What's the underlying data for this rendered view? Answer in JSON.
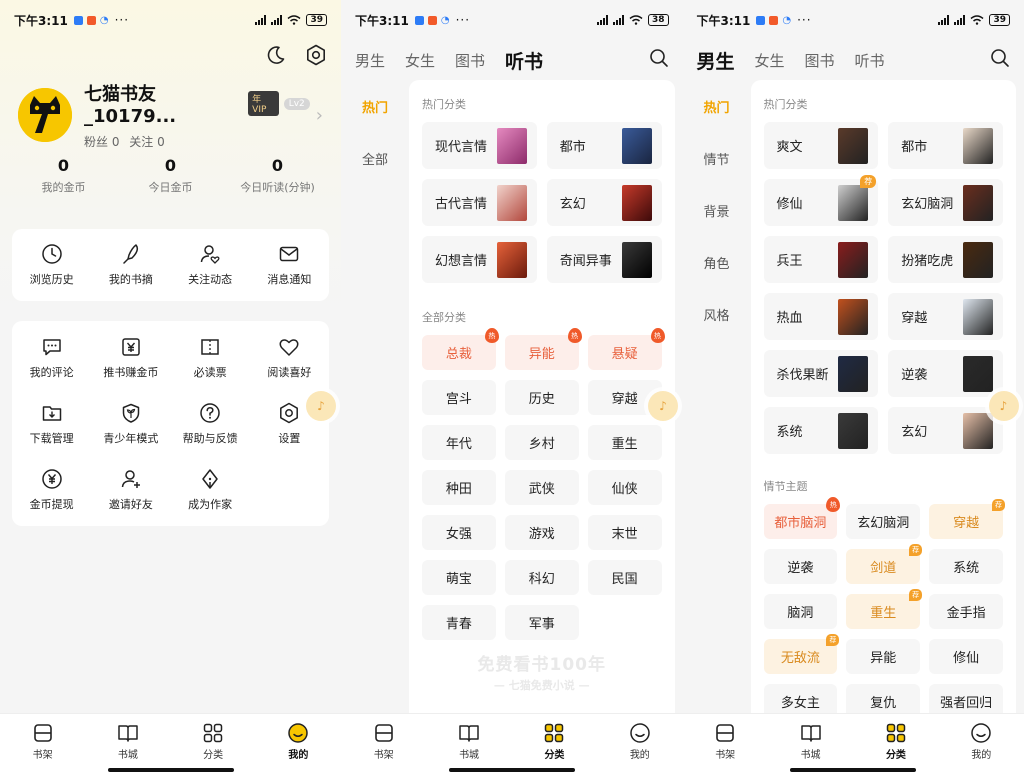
{
  "status_bar": [
    {
      "time": "下午3:11",
      "battery": "39"
    },
    {
      "time": "下午3:11",
      "battery": "38"
    },
    {
      "time": "下午3:11",
      "battery": "39"
    }
  ],
  "profile": {
    "username": "七猫书友_10179...",
    "vip_badge": "年VIP",
    "level_badge": "Lv2",
    "fans_label": "粉丝 0",
    "follow_label": "关注 0",
    "stats": [
      {
        "value": "0",
        "label": "我的金币"
      },
      {
        "value": "0",
        "label": "今日金币"
      },
      {
        "value": "0",
        "label": "今日听读(分钟)"
      }
    ],
    "quick_tools": [
      {
        "label": "浏览历史",
        "icon": "clock-icon"
      },
      {
        "label": "我的书摘",
        "icon": "pen-icon"
      },
      {
        "label": "关注动态",
        "icon": "user-heart-icon"
      },
      {
        "label": "消息通知",
        "icon": "mail-icon"
      }
    ],
    "tools": [
      {
        "label": "我的评论",
        "icon": "comment-icon"
      },
      {
        "label": "推书赚金币",
        "icon": "yen-box-icon"
      },
      {
        "label": "必读票",
        "icon": "ticket-icon"
      },
      {
        "label": "阅读喜好",
        "icon": "heart-icon"
      },
      {
        "label": "下载管理",
        "icon": "download-folder-icon"
      },
      {
        "label": "青少年模式",
        "icon": "sprout-shield-icon"
      },
      {
        "label": "帮助与反馈",
        "icon": "help-icon"
      },
      {
        "label": "设置",
        "icon": "gear-icon"
      },
      {
        "label": "金币提现",
        "icon": "yen-circle-icon"
      },
      {
        "label": "邀请好友",
        "icon": "add-user-icon"
      },
      {
        "label": "成为作家",
        "icon": "pen-nib-icon"
      }
    ]
  },
  "bottom_nav": [
    {
      "label": "书架",
      "icon": "bookshelf-icon"
    },
    {
      "label": "书城",
      "icon": "book-icon"
    },
    {
      "label": "分类",
      "icon": "grid-icon"
    },
    {
      "label": "我的",
      "icon": "smile-icon"
    }
  ],
  "category_tabs": [
    "男生",
    "女生",
    "图书",
    "听书"
  ],
  "audio": {
    "active_tab": "听书",
    "left_nav": [
      "热门",
      "全部"
    ],
    "hot_section_title": "热门分类",
    "hot": [
      {
        "label": "现代言情",
        "cover": "#c43b86"
      },
      {
        "label": "都市",
        "cover": "#2c3f6a"
      },
      {
        "label": "古代言情",
        "cover": "#d7a6a0"
      },
      {
        "label": "玄幻",
        "cover": "#7a1414"
      },
      {
        "label": "幻想言情",
        "cover": "#b9381e"
      },
      {
        "label": "奇闻异事",
        "cover": "#1a1a1a"
      }
    ],
    "all_section_title": "全部分类",
    "all": [
      {
        "label": "总裁",
        "hot": true
      },
      {
        "label": "异能",
        "hot": true
      },
      {
        "label": "悬疑",
        "hot": true
      },
      {
        "label": "宫斗"
      },
      {
        "label": "历史"
      },
      {
        "label": "穿越"
      },
      {
        "label": "年代"
      },
      {
        "label": "乡村"
      },
      {
        "label": "重生"
      },
      {
        "label": "种田"
      },
      {
        "label": "武侠"
      },
      {
        "label": "仙侠"
      },
      {
        "label": "女强"
      },
      {
        "label": "游戏"
      },
      {
        "label": "末世"
      },
      {
        "label": "萌宝"
      },
      {
        "label": "科幻"
      },
      {
        "label": "民国"
      },
      {
        "label": "青春"
      },
      {
        "label": "军事"
      }
    ],
    "hot_marker": "热",
    "watermark_big": "免费看书100年",
    "watermark_small": "— 七猫免费小说 —"
  },
  "male": {
    "active_tab": "男生",
    "left_nav": [
      "热门",
      "情节",
      "背景",
      "角色",
      "风格"
    ],
    "hot_section_title": "热门分类",
    "hot": [
      {
        "label": "爽文",
        "cover": "#5a3a2a"
      },
      {
        "label": "都市",
        "cover": "#e9d9c9"
      },
      {
        "label": "修仙",
        "cover": "#cfcfcf",
        "rec": true
      },
      {
        "label": "玄幻脑洞",
        "cover": "#6b2e1e"
      },
      {
        "label": "兵王",
        "cover": "#8a1d1d"
      },
      {
        "label": "扮猪吃虎",
        "cover": "#4a2a10"
      },
      {
        "label": "热血",
        "cover": "#c2511e"
      },
      {
        "label": "穿越",
        "cover": "#dfe7ef"
      },
      {
        "label": "杀伐果断",
        "cover": "#1f2a44"
      },
      {
        "label": "逆袭",
        "cover": "#2a2a2a"
      },
      {
        "label": "系统",
        "cover": "#3a3a3a"
      },
      {
        "label": "玄幻",
        "cover": "#e6c0a8"
      }
    ],
    "plot_section_title": "情节主题",
    "plot": [
      {
        "label": "都市脑洞",
        "style": "hot"
      },
      {
        "label": "玄幻脑洞"
      },
      {
        "label": "穿越",
        "style": "rec"
      },
      {
        "label": "逆袭"
      },
      {
        "label": "剑道",
        "style": "rec"
      },
      {
        "label": "系统"
      },
      {
        "label": "脑洞"
      },
      {
        "label": "重生",
        "style": "rec"
      },
      {
        "label": "金手指"
      },
      {
        "label": "无敌流",
        "style": "rec"
      },
      {
        "label": "异能"
      },
      {
        "label": "修仙"
      },
      {
        "label": "多女主"
      },
      {
        "label": "复仇"
      },
      {
        "label": "强者回归"
      }
    ],
    "rec_marker": "荐",
    "hot_marker": "热"
  },
  "colors": {
    "accent": "#f7c600",
    "active_left_nav": "#f1a400",
    "hot_red": "#e8603c",
    "rec_orange": "#f4a12a"
  }
}
